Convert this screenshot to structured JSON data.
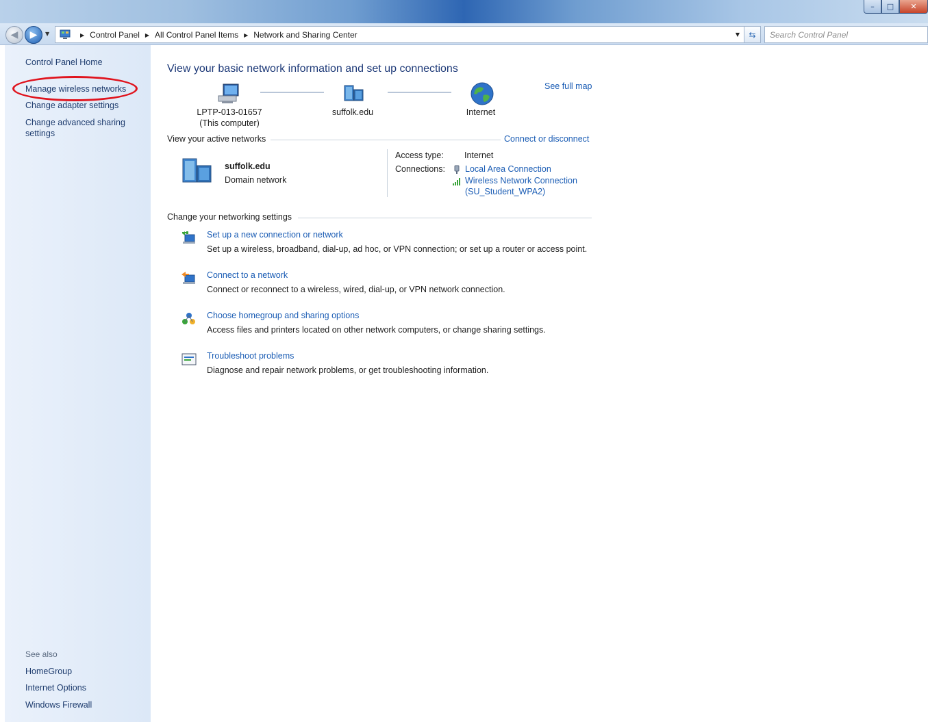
{
  "window": {
    "title": "",
    "controls": {
      "minimize": "–",
      "maximize": "□",
      "close": "✕"
    }
  },
  "navbar": {
    "back_icon": "back-arrow-icon",
    "forward_icon": "forward-arrow-icon",
    "breadcrumbs": [
      "Control Panel",
      "All Control Panel Items",
      "Network and Sharing Center"
    ],
    "search_placeholder": "Search Control Panel"
  },
  "sidebar": {
    "home": "Control Panel Home",
    "manage_wireless": "Manage wireless networks",
    "change_adapter": "Change adapter settings",
    "change_advanced": "Change advanced sharing settings",
    "see_also_label": "See also",
    "see_also": [
      "HomeGroup",
      "Internet Options",
      "Windows Firewall"
    ],
    "highlight_color": "#e0141e"
  },
  "main": {
    "title": "View your basic network information and set up connections",
    "see_full_map": "See full map",
    "map": {
      "computer_name": "LPTP-013-01657",
      "computer_sub": "(This computer)",
      "network": "suffolk.edu",
      "internet": "Internet"
    },
    "active_networks": {
      "heading": "View your active networks",
      "connect_disconnect": "Connect or disconnect",
      "network_name": "suffolk.edu",
      "network_type": "Domain network",
      "access_type_label": "Access type:",
      "access_type_value": "Internet",
      "connections_label": "Connections:",
      "connections": [
        "Local Area Connection",
        "Wireless Network Connection"
      ],
      "wireless_ssid": "(SU_Student_WPA2)"
    },
    "settings": {
      "heading": "Change your networking settings",
      "tasks": [
        {
          "link": "Set up a new connection or network",
          "desc": "Set up a wireless, broadband, dial-up, ad hoc, or VPN connection; or set up a router or access point."
        },
        {
          "link": "Connect to a network",
          "desc": "Connect or reconnect to a wireless, wired, dial-up, or VPN network connection."
        },
        {
          "link": "Choose homegroup and sharing options",
          "desc": "Access files and printers located on other network computers, or change sharing settings."
        },
        {
          "link": "Troubleshoot problems",
          "desc": "Diagnose and repair network problems, or get troubleshooting information."
        }
      ]
    }
  },
  "colors": {
    "link": "#1a5cb4",
    "title": "#1e3a78",
    "sidebar_bg": "#dce8f7"
  }
}
